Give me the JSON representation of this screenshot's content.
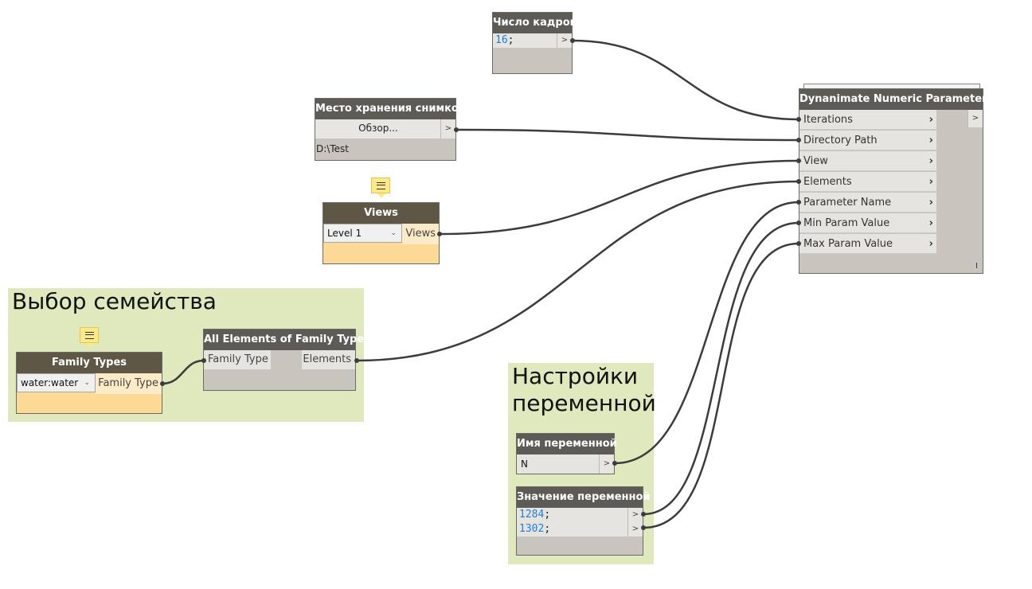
{
  "groups": [
    {
      "title": "Выбор семейства"
    },
    {
      "title": "Настройки\nпеременной"
    }
  ],
  "nodes": {
    "frame_count": {
      "title": "Число кадров",
      "value": "16",
      "semicolon": ";",
      "output": ">"
    },
    "storage": {
      "title": "Место хранения снимков",
      "button": "Обзор...",
      "path": "D:\\Test",
      "output": ">"
    },
    "views": {
      "title": "Views",
      "selected": "Level 1",
      "output_label": "Views"
    },
    "family_types": {
      "title": "Family Types",
      "selected": "water:water",
      "output_label": "Family Type"
    },
    "all_elements": {
      "title": "All Elements of Family Type",
      "input_label": "Family Type",
      "output_label": "Elements"
    },
    "var_name": {
      "title": "Имя переменной",
      "value": "N",
      "output": ">"
    },
    "var_values": {
      "title": "Значение переменной",
      "values": [
        "1284",
        "1302"
      ],
      "semicolon": ";",
      "output": ">"
    },
    "dynanimate": {
      "title": "Dynanimate Numeric Parameter",
      "inputs": [
        "Iterations",
        "Directory Path",
        "View",
        "Elements",
        "Parameter Name",
        "Min Param Value",
        "Max Param Value"
      ],
      "output": ">",
      "lacing": "I"
    }
  },
  "colors": {
    "wire": "#3c3c3c",
    "group_bg": "#e0e8bd",
    "node_header": "#5e5b57",
    "code_number": "#1e7fd8"
  }
}
